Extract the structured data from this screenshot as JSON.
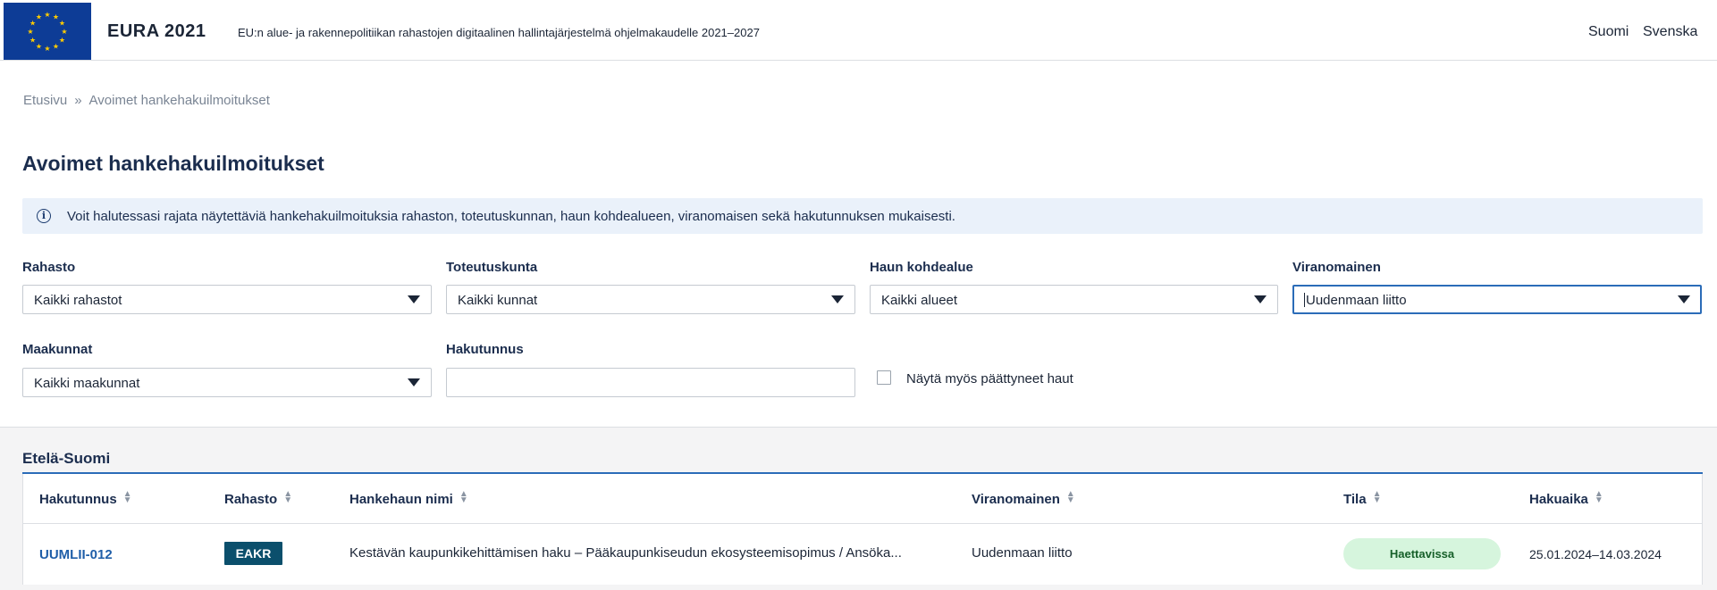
{
  "header": {
    "brand": "EURA 2021",
    "tagline": "EU:n alue- ja rakennepolitiikan rahastojen digitaalinen hallintajärjestelmä ohjelmakaudelle 2021–2027",
    "languages": [
      "Suomi",
      "Svenska"
    ]
  },
  "breadcrumb": {
    "home": "Etusivu",
    "separator": "»",
    "current": "Avoimet hankehakuilmoitukset"
  },
  "page_title": "Avoimet hankehakuilmoitukset",
  "info_text": "Voit halutessasi rajata näytettäviä hankehakuilmoituksia rahaston, toteutuskunnan, haun kohdealueen, viranomaisen sekä hakutunnuksen mukaisesti.",
  "filters": {
    "rahasto": {
      "label": "Rahasto",
      "value": "Kaikki rahastot"
    },
    "toteutuskunta": {
      "label": "Toteutuskunta",
      "value": "Kaikki kunnat"
    },
    "kohdealue": {
      "label": "Haun kohdealue",
      "value": "Kaikki alueet"
    },
    "viranomainen": {
      "label": "Viranomainen",
      "value": "Uudenmaan liitto"
    },
    "maakunnat": {
      "label": "Maakunnat",
      "value": "Kaikki maakunnat"
    },
    "hakutunnus": {
      "label": "Hakutunnus",
      "value": ""
    },
    "show_ended": {
      "label": "Näytä myös päättyneet haut",
      "checked": false
    }
  },
  "results": {
    "region": "Etelä-Suomi",
    "columns": [
      "Hakutunnus",
      "Rahasto",
      "Hankehaun nimi",
      "Viranomainen",
      "Tila",
      "Hakuaika"
    ],
    "rows": [
      {
        "hakutunnus": "UUMLII-012",
        "rahasto": "EAKR",
        "nimi": "Kestävän kaupunkikehittämisen haku – Pääkaupunkiseudun ekosysteemisopimus / Ansöka...",
        "viranomainen": "Uudenmaan liitto",
        "tila": "Haettavissa",
        "hakuaika": "25.01.2024–14.03.2024"
      }
    ]
  },
  "colors": {
    "flag_blue": "#0d3c96",
    "accent_blue": "#2b6cb8",
    "fund_badge": "#0b4f6c",
    "status_bg": "#d6f5dd",
    "info_bg": "#eaf1fa"
  },
  "icons": [
    "eu-flag-logo",
    "info-icon",
    "chevron-down-icon",
    "sort-icon"
  ]
}
